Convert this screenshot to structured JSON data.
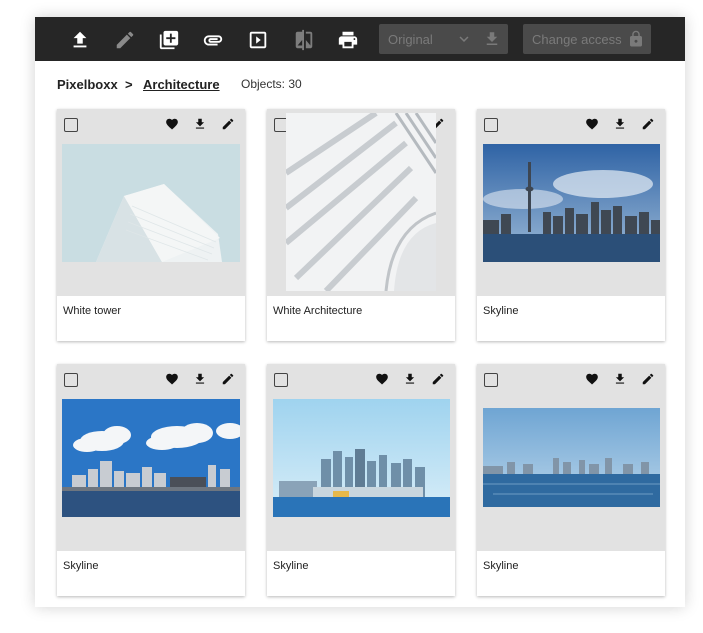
{
  "toolbar": {
    "buttons": [
      {
        "name": "upload-button",
        "icon": "upload-icon"
      },
      {
        "name": "edit-button",
        "icon": "pencil-icon"
      },
      {
        "name": "add-button",
        "icon": "add-box-icon"
      },
      {
        "name": "attach-button",
        "icon": "paperclip-icon"
      },
      {
        "name": "slideshow-button",
        "icon": "play-icon"
      },
      {
        "name": "compare-button",
        "icon": "compare-icon"
      },
      {
        "name": "print-button",
        "icon": "printer-icon"
      }
    ],
    "size_select": {
      "value": "Original"
    },
    "access_select": {
      "value": "Change access"
    }
  },
  "breadcrumb": {
    "root": "Pixelboxx",
    "separator": ">",
    "current": "Architecture",
    "count": "Objects: 30"
  },
  "cards": [
    {
      "title": "White tower",
      "image": "white-tower-photo"
    },
    {
      "title": "White Architecture",
      "image": "white-architecture-photo"
    },
    {
      "title": "Skyline",
      "image": "skyline-photo"
    },
    {
      "title": "Skyline",
      "image": "skyline-photo"
    },
    {
      "title": "Skyline",
      "image": "skyline-photo"
    },
    {
      "title": "Skyline",
      "image": "skyline-photo"
    }
  ],
  "colors": {
    "toolbar_bg": "#262626",
    "card_media_bg": "#e2e2e2",
    "icon_dark": "#222222"
  }
}
